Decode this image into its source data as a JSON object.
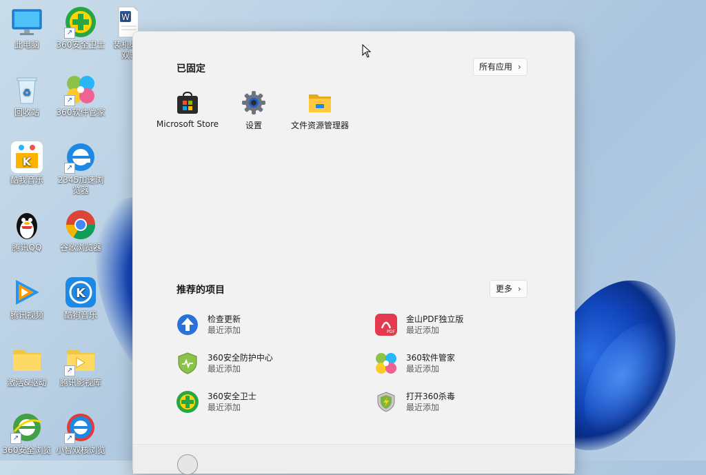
{
  "desktop": {
    "icons": [
      {
        "label": "此电脑",
        "icon": "computer-icon"
      },
      {
        "label": "360安全卫士",
        "icon": "360-safe-icon"
      },
      {
        "label": "装机必",
        "icon": "word-doc-icon"
      },
      {
        "label": "双击",
        "icon": ""
      },
      {
        "label": "回收站",
        "icon": "recycle-bin-icon"
      },
      {
        "label": "360软件管家",
        "icon": "360-software-icon"
      },
      {
        "label": "酷我音乐",
        "icon": "kuwo-music-icon"
      },
      {
        "label": "2345加速浏",
        "icon": "ie-browser-icon"
      },
      {
        "label": "览器",
        "icon": ""
      },
      {
        "label": "腾讯QQ",
        "icon": "qq-icon"
      },
      {
        "label": "谷歌浏览器",
        "icon": "chrome-icon"
      },
      {
        "label": "腾讯视频",
        "icon": "tencent-video-icon"
      },
      {
        "label": "酷狗音乐",
        "icon": "kugou-music-icon"
      },
      {
        "label": "激活&驱动",
        "icon": "folder-icon"
      },
      {
        "label": "腾讯影视库",
        "icon": "video-folder-icon"
      },
      {
        "label": "360安全浏览",
        "icon": "360-browser-icon"
      },
      {
        "label": "小智双核浏览",
        "icon": "xiaozhi-browser-icon"
      }
    ]
  },
  "start_menu": {
    "pinned_title": "已固定",
    "all_apps_label": "所有应用",
    "chevron": "›",
    "pinned": [
      {
        "label": "Microsoft Store",
        "icon": "store-icon"
      },
      {
        "label": "设置",
        "icon": "settings-gear-icon"
      },
      {
        "label": "文件资源管理器",
        "icon": "file-explorer-icon"
      }
    ],
    "recommended_title": "推荐的项目",
    "more_label": "更多",
    "recommended": [
      {
        "name": "检查更新",
        "sub": "最近添加",
        "icon": "update-arrow-icon"
      },
      {
        "name": "金山PDF独立版",
        "sub": "最近添加",
        "icon": "pdf-icon"
      },
      {
        "name": "360安全防护中心",
        "sub": "最近添加",
        "icon": "shield-icon"
      },
      {
        "name": "360软件管家",
        "sub": "最近添加",
        "icon": "360-software-icon"
      },
      {
        "name": "360安全卫士",
        "sub": "最近添加",
        "icon": "360-safe-icon"
      },
      {
        "name": "打开360杀毒",
        "sub": "最近添加",
        "icon": "360-antivirus-icon"
      }
    ]
  },
  "colors": {
    "accent": "#0067c0",
    "menu_bg": "#f2f2f2"
  }
}
